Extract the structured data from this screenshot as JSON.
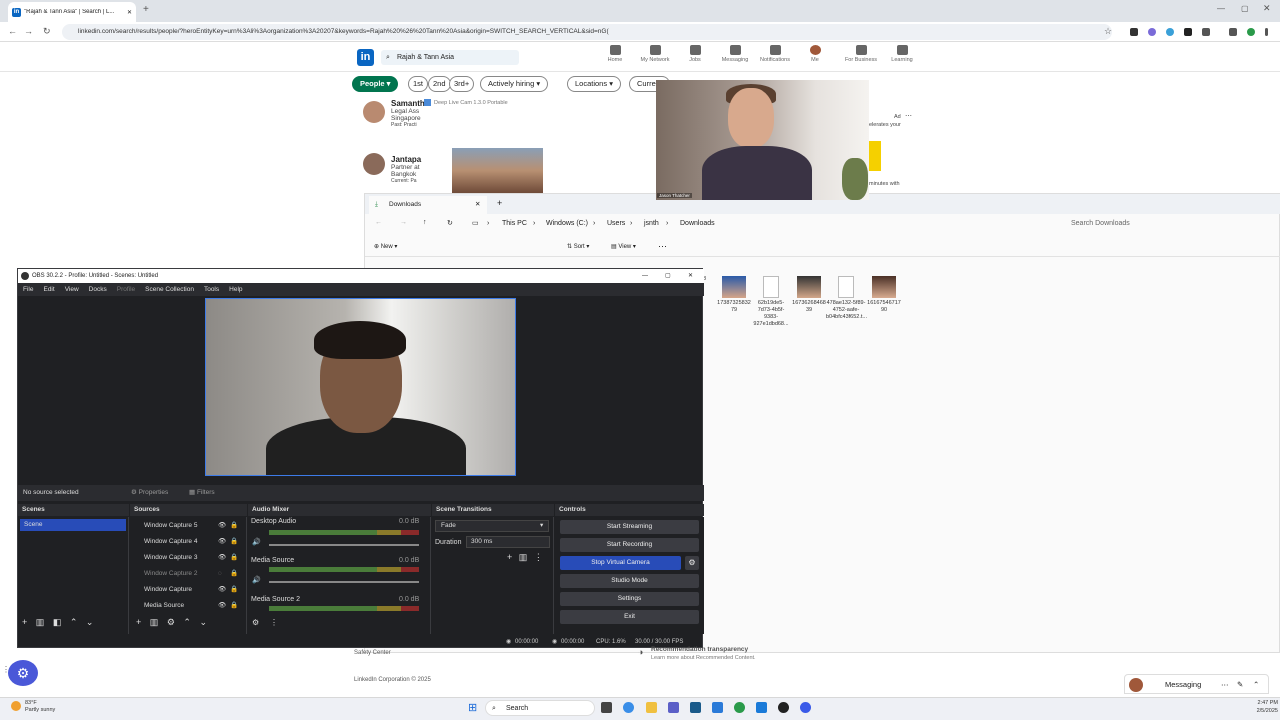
{
  "browser": {
    "tab_title": "\"Rajah & Tann Asia\" | Search | L...",
    "url": "linkedin.com/search/results/people/?heroEntityKey=urn%3Ali%3Aorganization%3A20207&keywords=Rajah%20%26%20Tann%20Asia&origin=SWITCH_SEARCH_VERTICAL&sid=nG("
  },
  "linkedin": {
    "search_value": "Rajah & Tann Asia",
    "nav": [
      "Home",
      "My Network",
      "Jobs",
      "Messaging",
      "Notifications",
      "Me",
      "For Business",
      "Learning"
    ],
    "filters": [
      "People",
      "1st",
      "2nd",
      "3rd+",
      "Actively hiring",
      "Locations",
      "Current"
    ],
    "results": [
      {
        "name": "Samanth",
        "line1": "Legal Ass",
        "line2": "Singapore",
        "line3": "Past: Practi"
      },
      {
        "name": "Jantapa",
        "line1": "Partner at",
        "line2": "Bangkok",
        "line3": "Current: Pa"
      }
    ],
    "ad": {
      "label": "Ad",
      "text1": "elerates your",
      "text2": "minutes with"
    },
    "footer": {
      "safety": "Safety Center",
      "transparency_title": "Recommendation transparency",
      "transparency_sub": "Learn more about Recommended Content.",
      "corp": "LinkedIn Corporation © 2025"
    },
    "messaging": "Messaging"
  },
  "deeplive": {
    "title": "Deep Live Cam 1.3.0 Portable"
  },
  "webcam": {
    "label": "Jason Thatcher"
  },
  "explorer": {
    "tab_title": "Downloads",
    "breadcrumb": [
      "This PC",
      "Windows (C:)",
      "Users",
      "jsnth",
      "Downloads"
    ],
    "search_placeholder": "Search Downloads",
    "cmd": [
      "New",
      "Sort",
      "View"
    ],
    "files": [
      {
        "name": "38",
        "type": "partial"
      },
      {
        "name": "17387325832 79",
        "type": "photo"
      },
      {
        "name": "62b19de5-7d73-4b5f-9383-927e1dbd68...",
        "type": "doc"
      },
      {
        "name": "16736268468 39",
        "type": "photo"
      },
      {
        "name": "478ae132-5f89-4752-aafe-b04bfc43f652.t...",
        "type": "doc"
      },
      {
        "name": "16167546717 90",
        "type": "photo"
      }
    ]
  },
  "obs": {
    "title": "OBS 30.2.2 - Profile: Untitled - Scenes: Untitled",
    "menu": [
      "File",
      "Edit",
      "View",
      "Docks",
      "Profile",
      "Scene Collection",
      "Tools",
      "Help"
    ],
    "no_source": "No source selected",
    "properties": "Properties",
    "filters": "Filters",
    "panels": {
      "scenes": "Scenes",
      "sources": "Sources",
      "mixer": "Audio Mixer",
      "transitions": "Scene Transitions",
      "controls": "Controls"
    },
    "scenes": [
      "Scene"
    ],
    "sources": [
      "Window Capture 5",
      "Window Capture 4",
      "Window Capture 3",
      "Window Capture 2",
      "Window Capture",
      "Media Source"
    ],
    "mixer": [
      {
        "name": "Desktop Audio",
        "db": "0.0 dB"
      },
      {
        "name": "Media Source",
        "db": "0.0 dB"
      },
      {
        "name": "Media Source 2",
        "db": "0.0 dB"
      }
    ],
    "transition": "Fade",
    "duration_label": "Duration",
    "duration_value": "300 ms",
    "controls": [
      "Start Streaming",
      "Start Recording",
      "Stop Virtual Camera",
      "Studio Mode",
      "Settings",
      "Exit"
    ],
    "status": {
      "time1": "00:00:00",
      "time2": "00:00:00",
      "cpu": "CPU: 1.6%",
      "fps": "30.00 / 30.00 FPS"
    }
  },
  "taskbar": {
    "weather_temp": "83°F",
    "weather_desc": "Partly sunny",
    "search": "Search",
    "time": "2:47 PM",
    "date": "2/5/2025"
  }
}
